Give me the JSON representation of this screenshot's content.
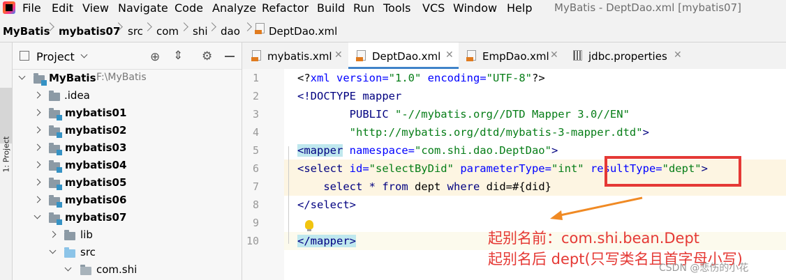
{
  "window": {
    "title": "MyBatis - DeptDao.xml [mybatis07]"
  },
  "menu": [
    {
      "label": "File"
    },
    {
      "label": "Edit"
    },
    {
      "label": "View"
    },
    {
      "label": "Navigate"
    },
    {
      "label": "Code"
    },
    {
      "label": "Analyze"
    },
    {
      "label": "Refactor"
    },
    {
      "label": "Build"
    },
    {
      "label": "Run"
    },
    {
      "label": "Tools"
    },
    {
      "label": "VCS"
    },
    {
      "label": "Window"
    },
    {
      "label": "Help"
    }
  ],
  "breadcrumb": [
    "MyBatis",
    "mybatis07",
    "src",
    "com",
    "shi",
    "dao",
    "DeptDao.xml"
  ],
  "left_stripe": {
    "label": "1: Project"
  },
  "project_panel": {
    "title": "Project",
    "tree": [
      {
        "label": "MyBatis",
        "suffix": "F:\\MyBatis"
      },
      {
        "label": ".idea"
      },
      {
        "label": "mybatis01"
      },
      {
        "label": "mybatis02"
      },
      {
        "label": "mybatis03"
      },
      {
        "label": "mybatis04"
      },
      {
        "label": "mybatis05"
      },
      {
        "label": "mybatis06"
      },
      {
        "label": "mybatis07"
      },
      {
        "label": "lib"
      },
      {
        "label": "src"
      },
      {
        "label": "com.shi"
      }
    ]
  },
  "tabs": [
    {
      "label": "mybatis.xml",
      "icon": "xml-file-icon"
    },
    {
      "label": "DeptDao.xml",
      "icon": "xml-file-icon",
      "active": true
    },
    {
      "label": "EmpDao.xml",
      "icon": "xml-file-icon"
    },
    {
      "label": "jdbc.properties",
      "icon": "properties-file-icon"
    }
  ],
  "editor": {
    "line_numbers": [
      "1",
      "2",
      "3",
      "4",
      "5",
      "6",
      "7",
      "8",
      "9",
      "10"
    ],
    "lines": {
      "l1": {
        "a": "<?",
        "b": "xml",
        "c": " version=",
        "d": "\"1.0\"",
        "e": " encoding=",
        "f": "\"UTF-8\"",
        "g": "?>"
      },
      "l2": {
        "a": "<!DOCTYPE ",
        "b": "mapper"
      },
      "l3": {
        "a": "        PUBLIC ",
        "b": "\"-//mybatis.org//DTD Mapper 3.0//EN\""
      },
      "l4": {
        "a": "        ",
        "b": "\"http://mybatis.org/dtd/mybatis-3-mapper.dtd\"",
        "c": ">"
      },
      "l5": {
        "a": "<mapper",
        "b": " namespace=",
        "c": "\"com.shi.dao.DeptDao\"",
        "d": ">"
      },
      "l6": {
        "a": "<select",
        "b": " id=",
        "c": "\"selectByDid\"",
        "d": " parameterType=",
        "e": "\"int\"",
        "f": " resultType=",
        "g": "\"dept\"",
        "h": ">"
      },
      "l7": {
        "a": "    select * ",
        "b": "from ",
        "c": "dept ",
        "d": "where ",
        "e": "did=#{did}"
      },
      "l8": {
        "a": "</select",
        "b": ">"
      },
      "l10": {
        "a": "</mapper",
        "b": ">"
      }
    }
  },
  "annotations": {
    "line1": "起别名前：com.shi.bean.Dept",
    "line2": "起别名后 dept(只写类名且首字母小写)"
  },
  "watermark": "CSDN @悲伤的小花",
  "colors": {
    "annotation": "#e53935",
    "active_tab_underline": "#4083c9",
    "highlight_line": "#fdf5e2"
  }
}
